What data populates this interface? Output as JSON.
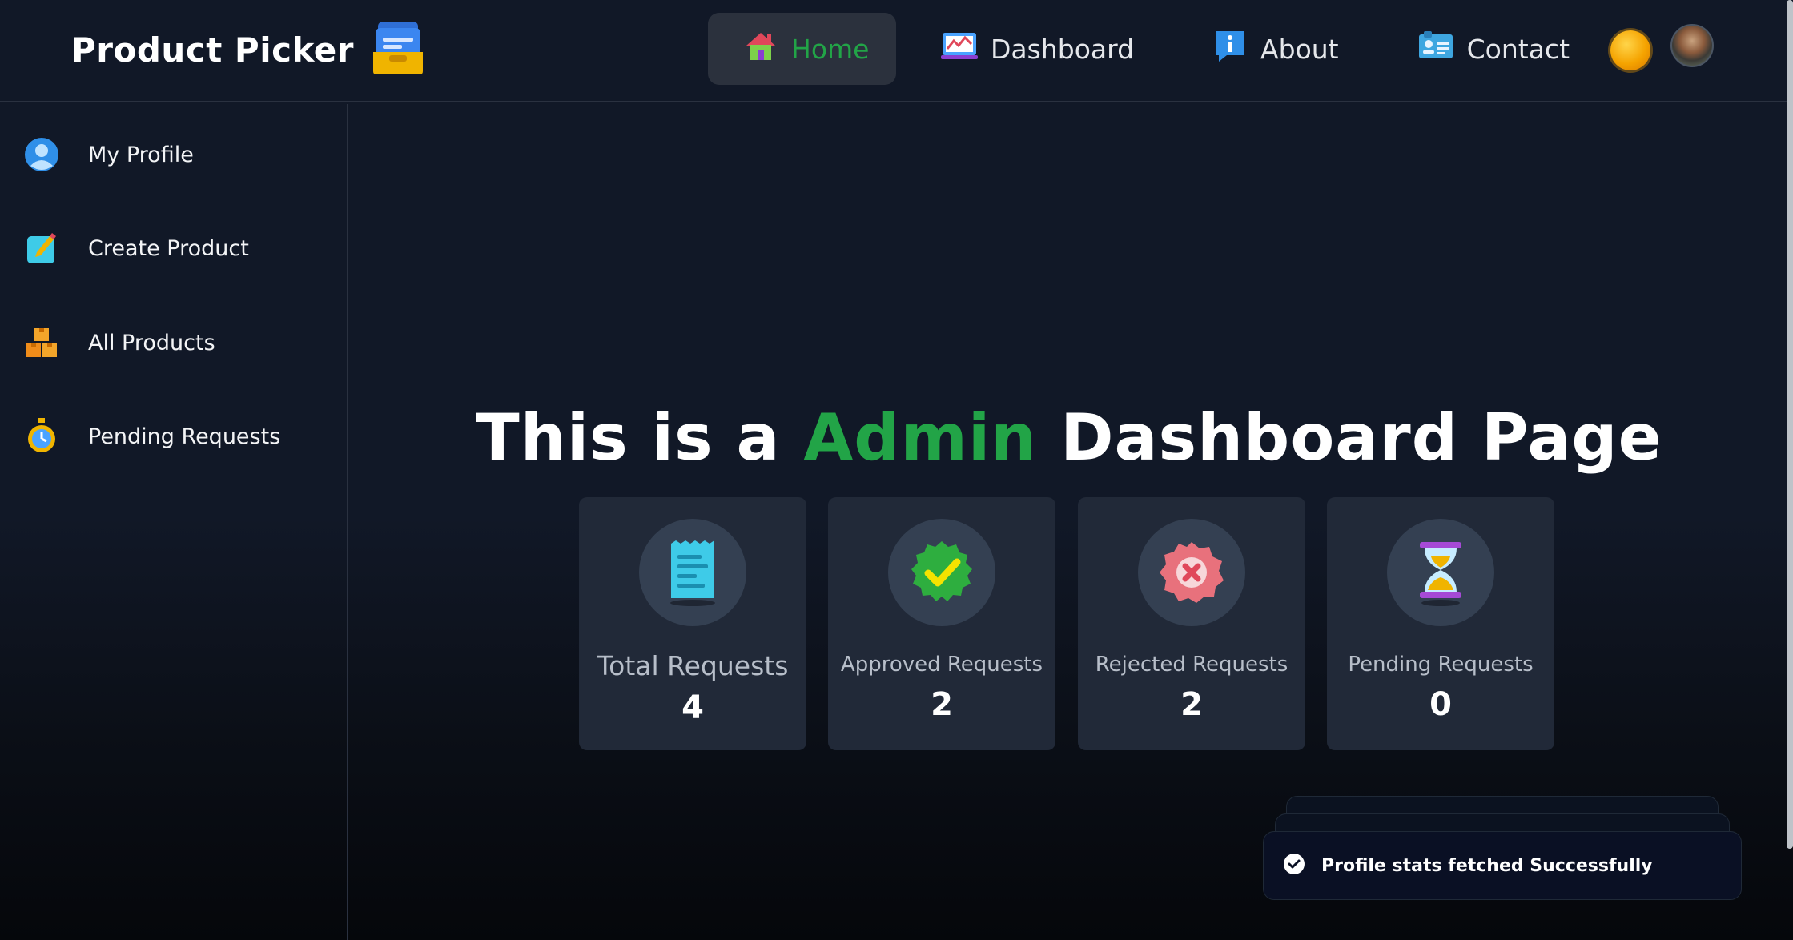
{
  "navbar": {
    "brand_title": "Product Picker",
    "brand_icon": "card-file-box-icon",
    "items": [
      {
        "label": "Home",
        "icon": "house-icon",
        "active": true
      },
      {
        "label": "Dashboard",
        "icon": "chart-icon",
        "active": false
      },
      {
        "label": "About",
        "icon": "info-icon",
        "active": false
      },
      {
        "label": "Contact",
        "icon": "contact-card-icon",
        "active": false
      }
    ],
    "theme_toggle_icon": "sun-icon",
    "avatar": "user-avatar"
  },
  "sidebar": {
    "items": [
      {
        "label": "My Profile",
        "icon": "user-icon"
      },
      {
        "label": "Create Product",
        "icon": "memo-icon"
      },
      {
        "label": "All Products",
        "icon": "boxes-icon"
      },
      {
        "label": "Pending Requests",
        "icon": "stopwatch-icon"
      }
    ]
  },
  "main": {
    "heading_prefix": "This is a ",
    "heading_accent": "Admin",
    "heading_suffix": " Dashboard Page",
    "accent_color": "#22a447",
    "cards": [
      {
        "label": "Total Requests",
        "value": "4",
        "icon": "receipt-icon"
      },
      {
        "label": "Approved Requests",
        "value": "2",
        "icon": "check-badge-icon"
      },
      {
        "label": "Rejected Requests",
        "value": "2",
        "icon": "cross-badge-icon"
      },
      {
        "label": "Pending Requests",
        "value": "0",
        "icon": "hourglass-icon"
      }
    ]
  },
  "toast": {
    "message": "Profile stats fetched Successfully",
    "icon": "check-circle-icon"
  }
}
